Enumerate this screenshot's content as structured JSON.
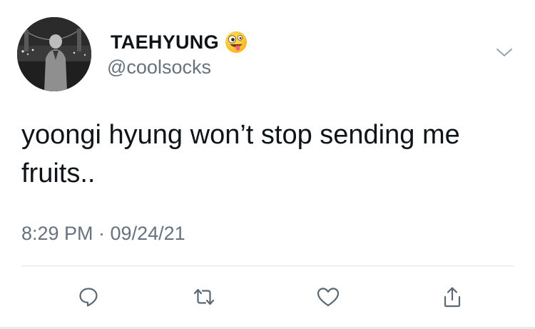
{
  "tweet": {
    "display_name": "TAEHYUNG",
    "display_name_emoji": "zany-face-emoji",
    "handle": "@coolsocks",
    "text": "yoongi hyung won’t stop sending me fruits..",
    "timestamp": "8:29 PM · 09/24/21"
  },
  "actions": [
    {
      "name": "reply",
      "icon": "comment-icon"
    },
    {
      "name": "retweet",
      "icon": "retweet-icon"
    },
    {
      "name": "like",
      "icon": "heart-icon"
    },
    {
      "name": "share",
      "icon": "share-icon"
    }
  ],
  "colors": {
    "text_primary": "#0f1419",
    "text_secondary": "#66727d",
    "icon": "#5b6873",
    "divider": "#dfe3e6"
  }
}
